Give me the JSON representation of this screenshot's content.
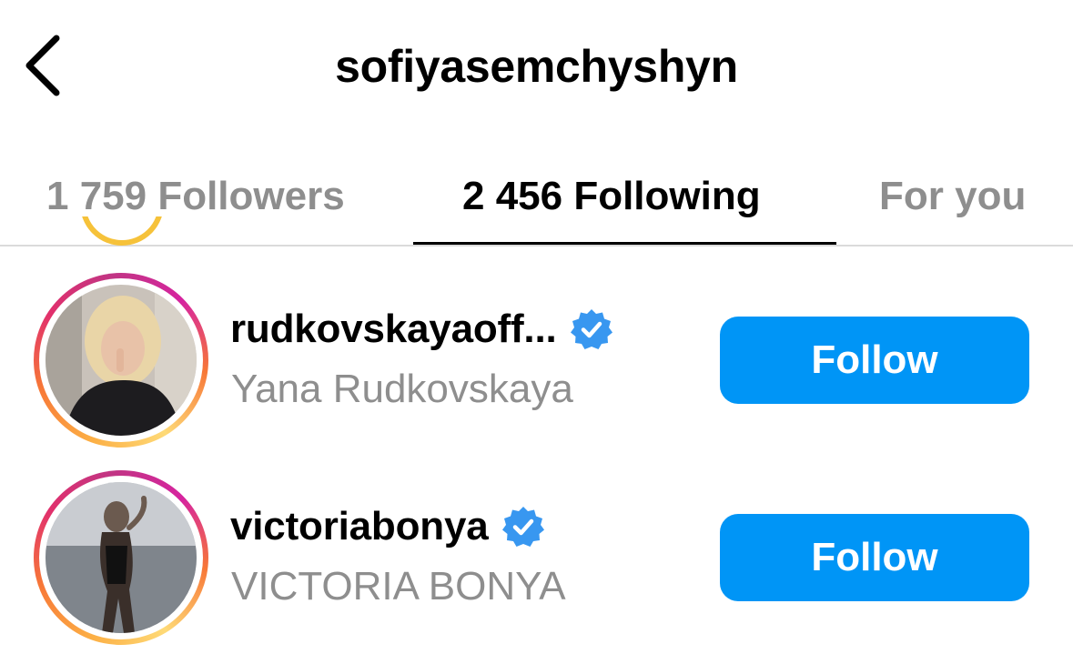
{
  "header": {
    "title": "sofiyasemchyshyn",
    "back_icon": "chevron-left-icon"
  },
  "tabs": [
    {
      "label": "1 759 Followers",
      "active": false
    },
    {
      "label": "2 456 Following",
      "active": true
    },
    {
      "label": "For you",
      "active": false
    }
  ],
  "colors": {
    "follow_button": "#0095f6",
    "verified_badge": "#3897f0",
    "secondary_text": "#8e8e8e"
  },
  "accounts": [
    {
      "username": "rudkovskayaoff...",
      "full_name": "Yana Rudkovskaya",
      "verified": true,
      "verified_icon": "verified-badge-icon",
      "button_label": "Follow"
    },
    {
      "username": "victoriabonya",
      "full_name": "VICTORIA BONYA",
      "verified": true,
      "verified_icon": "verified-badge-icon",
      "button_label": "Follow"
    }
  ]
}
